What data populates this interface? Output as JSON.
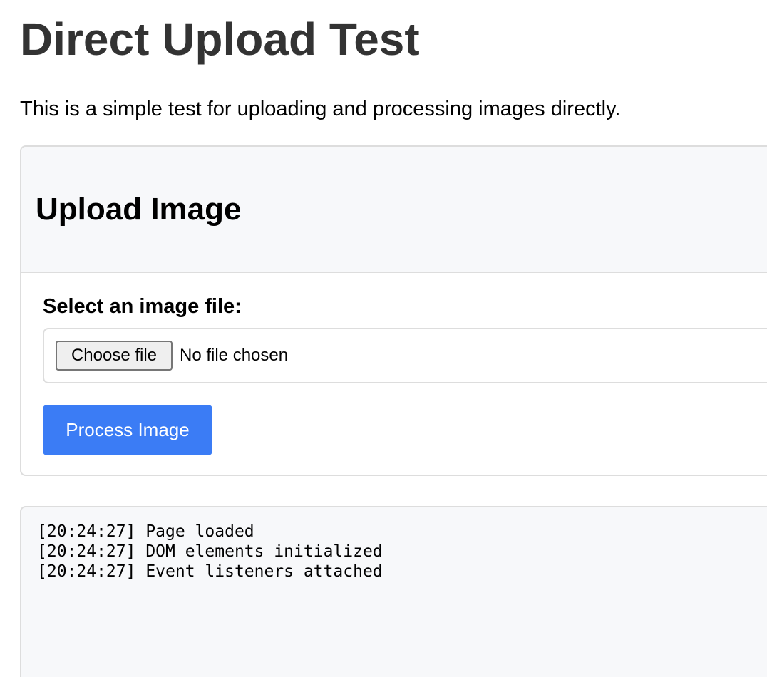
{
  "page": {
    "title": "Direct Upload Test",
    "intro": "This is a simple test for uploading and processing images directly."
  },
  "upload_card": {
    "title": "Upload Image",
    "field_label": "Select an image file:",
    "choose_file_label": "Choose file",
    "file_status": "No file chosen",
    "process_button_label": "Process Image"
  },
  "log": {
    "lines": [
      "[20:24:27] Page loaded",
      "[20:24:27] DOM elements initialized",
      "[20:24:27] Event listeners attached"
    ]
  },
  "colors": {
    "title_text": "#333333",
    "primary_button": "#3b7cf5",
    "panel_background": "#f7f8fa",
    "border": "#dddddd"
  }
}
